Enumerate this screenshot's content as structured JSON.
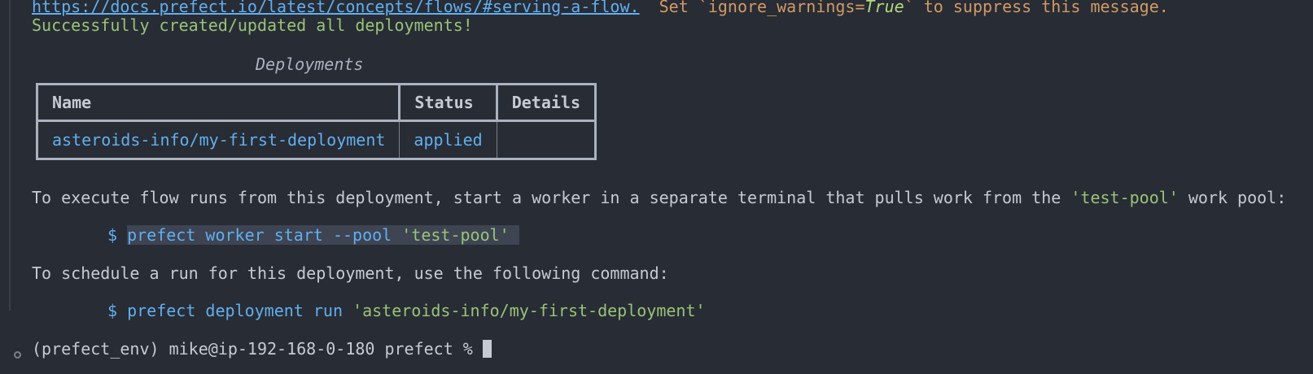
{
  "output": {
    "warning_link": "https://docs.prefect.io/latest/concepts/flows/#serving-a-flow.",
    "warning_text_pre": "  Set `ignore_warnings=",
    "warning_true": "True",
    "warning_text_post": "` to suppress this message.",
    "success": "Successfully created/updated all deployments!"
  },
  "table": {
    "title": "Deployments",
    "headers": [
      "Name",
      "Status",
      "Details"
    ],
    "rows": [
      {
        "name": "asteroids-info/my-first-deployment",
        "status": "applied",
        "details": ""
      }
    ]
  },
  "worker": {
    "text_pre": "To execute flow runs from this deployment, start a worker in a separate terminal that pulls work from the ",
    "pool_quoted": "'test-pool'",
    "text_post": " work pool:",
    "dollar": "$",
    "cmd": "prefect worker start --pool ",
    "cmd_arg": "'test-pool'"
  },
  "schedule": {
    "text": "To schedule a run for this deployment, use the following command:",
    "dollar": "$",
    "cmd": "prefect deployment run ",
    "cmd_arg": "'asteroids-info/my-first-deployment'"
  },
  "prompt": {
    "text": "(prefect_env) mike@ip-192-168-0-180 prefect % "
  },
  "colors": {
    "background": "#282c34",
    "link": "#61afef",
    "warning": "#d19a66",
    "success": "#98c379",
    "text": "#c6cbd3"
  }
}
